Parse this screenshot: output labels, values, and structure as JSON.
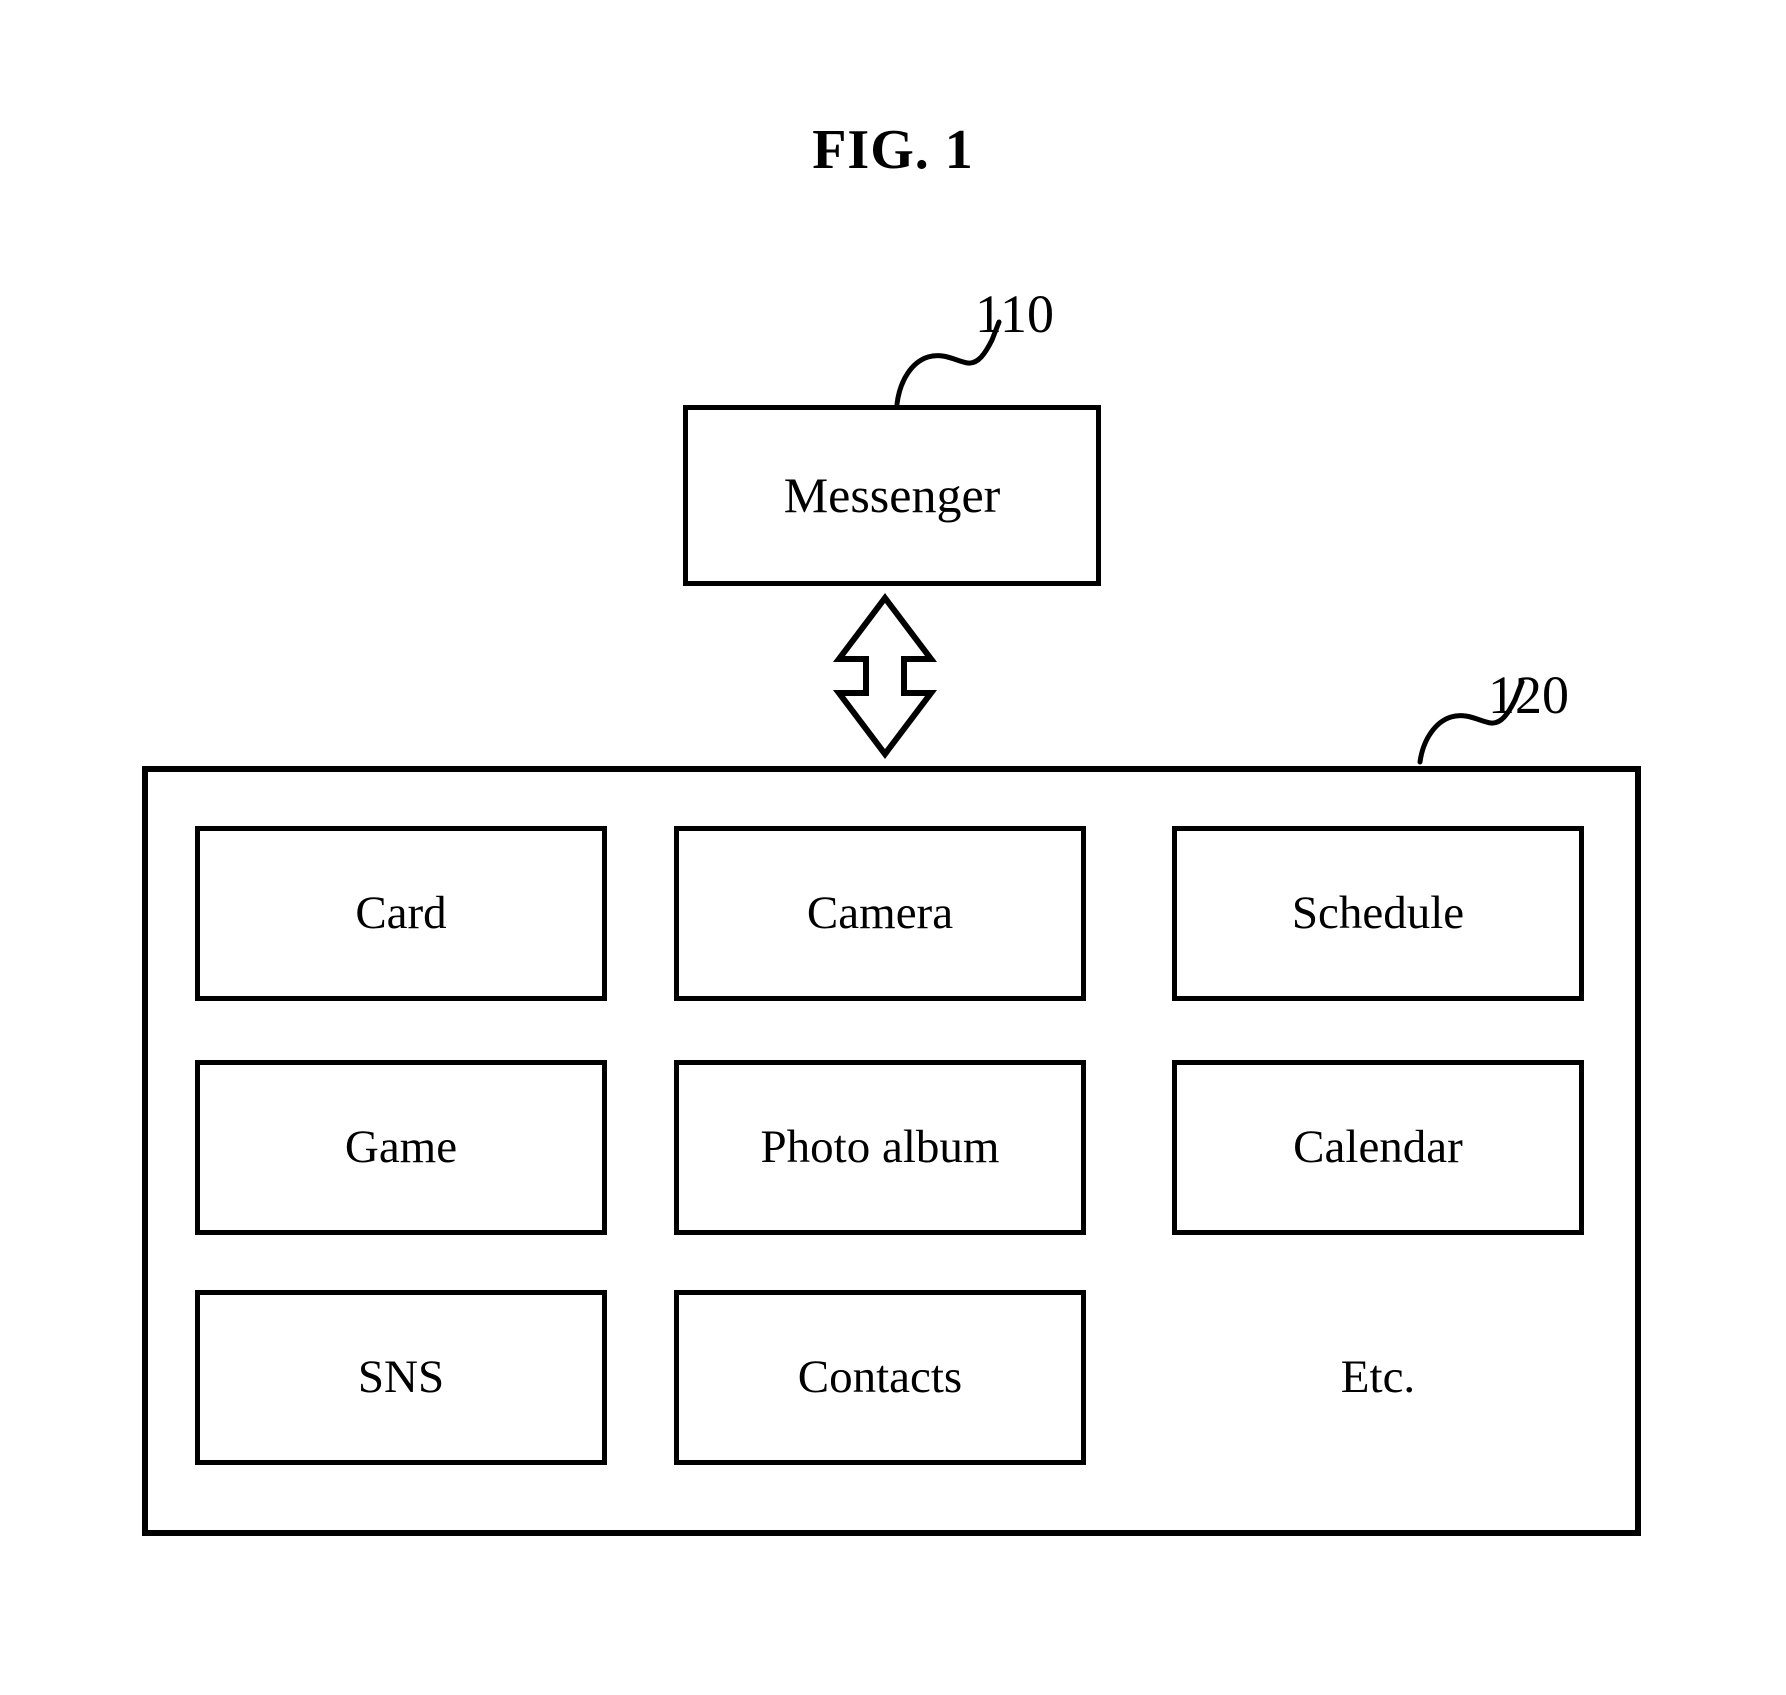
{
  "figure": {
    "title": "FIG. 1",
    "type": "patent-block-diagram"
  },
  "nodes": {
    "messenger": {
      "label": "Messenger",
      "reference_numeral": "110"
    },
    "application_container": {
      "reference_numeral": "120"
    }
  },
  "connector": {
    "kind": "double-headed-arrow",
    "orientation": "vertical",
    "from": "Messenger",
    "to": "application_container",
    "style": "hollow-outline"
  },
  "grid": {
    "rows": 3,
    "columns": 3,
    "cells": [
      {
        "label": "Card",
        "boxed": true
      },
      {
        "label": "Camera",
        "boxed": true
      },
      {
        "label": "Schedule",
        "boxed": true
      },
      {
        "label": "Game",
        "boxed": true
      },
      {
        "label": "Photo album",
        "boxed": true
      },
      {
        "label": "Calendar",
        "boxed": true
      },
      {
        "label": "SNS",
        "boxed": true
      },
      {
        "label": "Contacts",
        "boxed": true
      },
      {
        "label": "Etc.",
        "boxed": false
      }
    ]
  },
  "colors": {
    "stroke": "#000000",
    "fill": "#ffffff",
    "text": "#000000"
  }
}
